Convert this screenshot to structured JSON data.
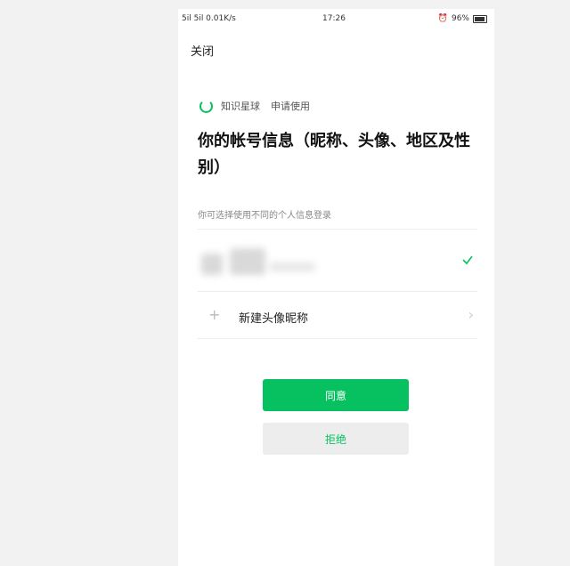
{
  "status_bar": {
    "signal": "5il 5il 0.01K/s",
    "time": "17:26",
    "battery": "96%"
  },
  "header": {
    "close_label": "关闭"
  },
  "app": {
    "name": "知识星球",
    "request_text": "申请使用"
  },
  "title": "你的帐号信息（昵称、头像、地区及性别）",
  "hint": "你可选择使用不同的个人信息登录",
  "accounts": [
    {
      "selected": true
    }
  ],
  "new_account_label": "新建头像昵称",
  "buttons": {
    "agree": "同意",
    "reject": "拒绝"
  },
  "colors": {
    "accent": "#07c160",
    "background": "#f2f2f2"
  }
}
